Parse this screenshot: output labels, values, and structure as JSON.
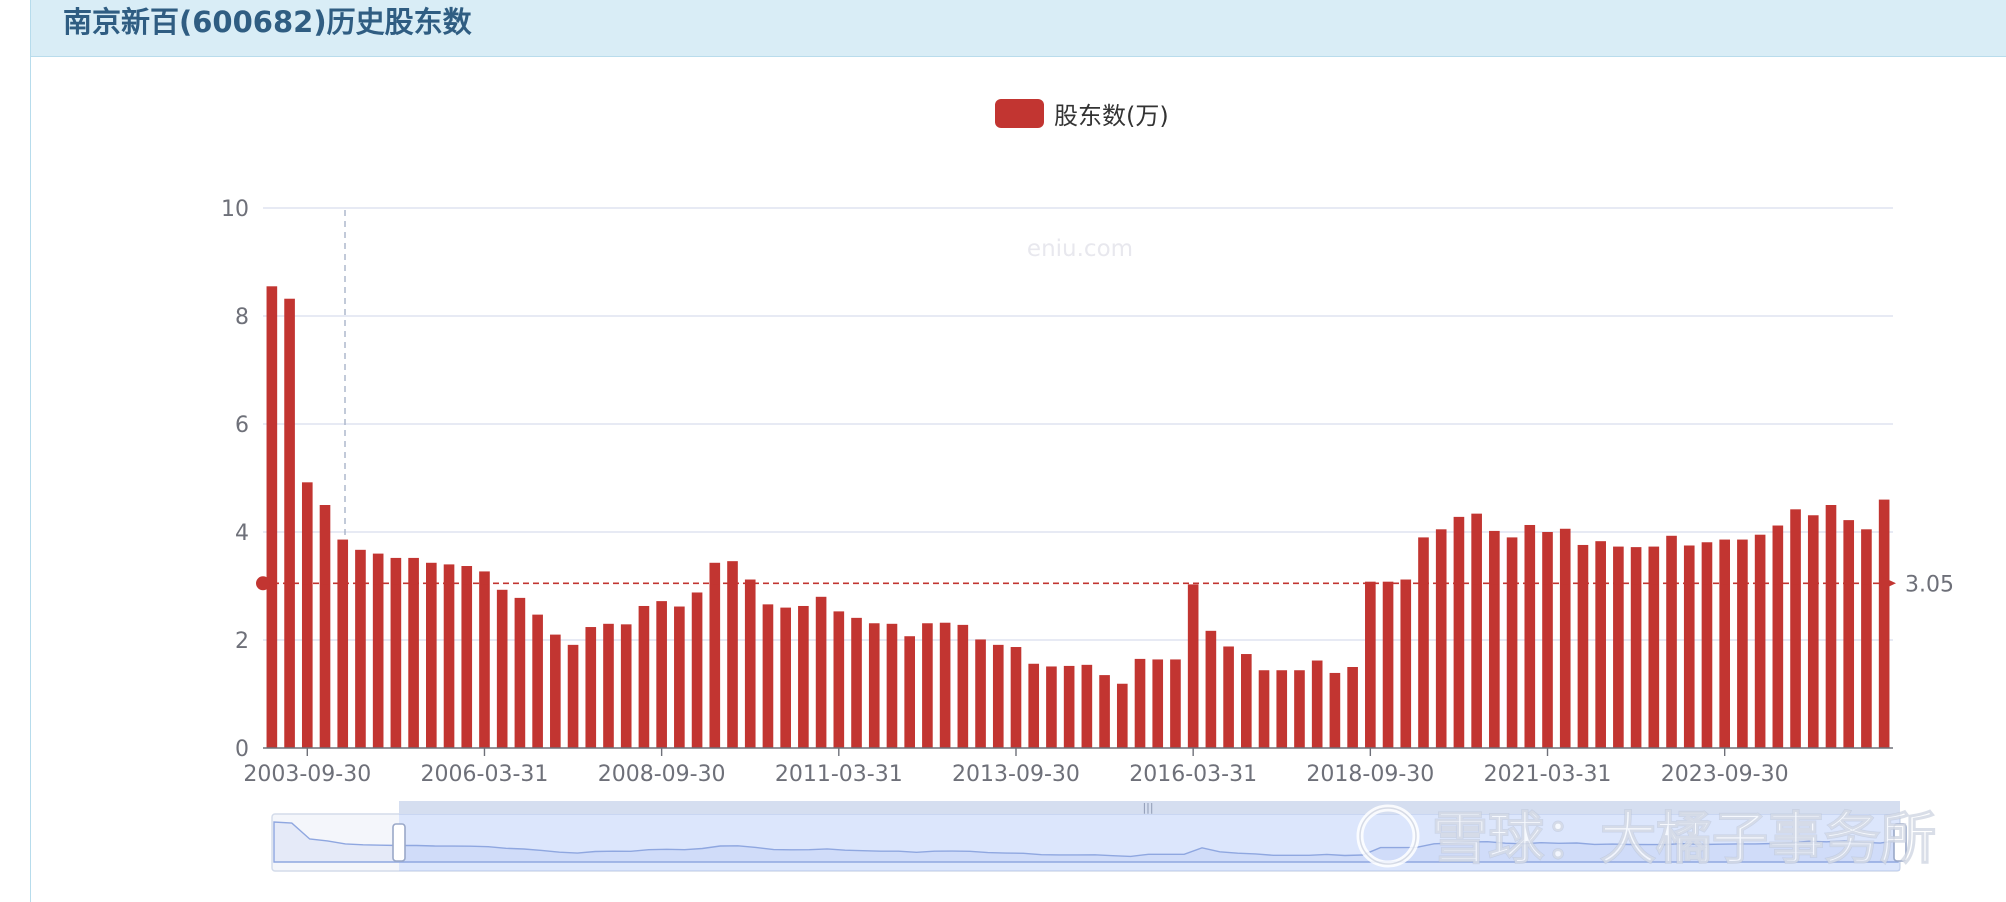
{
  "header": {
    "title": "南京新百(600682)历史股东数"
  },
  "colors": {
    "bar": "#c23531",
    "markline": "#c23531",
    "grid": "#dfe4f0",
    "axis": "#6e7079",
    "header_bg": "#d9edf6"
  },
  "watermark": {
    "site": "eniu.com",
    "xueqiu": "雪球：大橘子事务所"
  },
  "chart_data": {
    "type": "bar",
    "title": "南京新百(600682)历史股东数",
    "legend": [
      "股东数(万)"
    ],
    "legend_position": "top-center",
    "grid": true,
    "ylim": [
      0,
      10
    ],
    "yticks": [
      0,
      2,
      4,
      6,
      8,
      10
    ],
    "xtick_labels": [
      "2003-09-30",
      "2006-03-31",
      "2008-09-30",
      "2011-03-31",
      "2013-09-30",
      "2016-03-31",
      "2018-09-30",
      "2021-03-31",
      "2023-09-30"
    ],
    "markline": {
      "value": 3.05,
      "label": "3.05",
      "type": "average"
    },
    "series": [
      {
        "name": "股东数(万)",
        "values": [
          8.55,
          8.32,
          4.92,
          4.5,
          3.86,
          3.67,
          3.6,
          3.52,
          3.52,
          3.43,
          3.4,
          3.37,
          3.27,
          2.93,
          2.78,
          2.47,
          2.1,
          1.91,
          2.24,
          2.3,
          2.29,
          2.63,
          2.72,
          2.62,
          2.88,
          3.43,
          3.46,
          3.12,
          2.66,
          2.6,
          2.63,
          2.8,
          2.53,
          2.41,
          2.31,
          2.3,
          2.07,
          2.31,
          2.32,
          2.28,
          2.01,
          1.91,
          1.87,
          1.56,
          1.51,
          1.52,
          1.54,
          1.35,
          1.19,
          1.65,
          1.64,
          1.64,
          3.03,
          2.17,
          1.88,
          1.74,
          1.44,
          1.44,
          1.44,
          1.62,
          1.39,
          1.5,
          3.08,
          3.08,
          3.12,
          3.9,
          4.05,
          4.28,
          4.34,
          4.02,
          3.9,
          4.13,
          4.0,
          4.06,
          3.76,
          3.83,
          3.73,
          3.72,
          3.73,
          3.93,
          3.75,
          3.81,
          3.86,
          3.86,
          3.95,
          4.12,
          4.42,
          4.31,
          4.5,
          4.22,
          4.05,
          4.6
        ]
      }
    ]
  }
}
